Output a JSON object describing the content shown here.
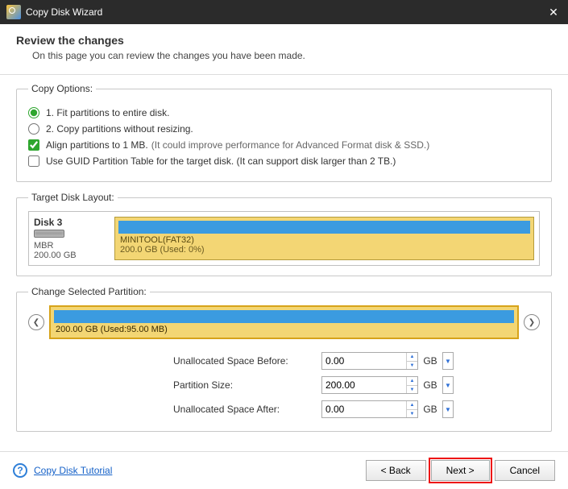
{
  "titlebar": {
    "title": "Copy Disk Wizard"
  },
  "header": {
    "title": "Review the changes",
    "subtitle": "On this page you can review the changes you have been made."
  },
  "copy_options": {
    "legend": "Copy Options:",
    "radio1": "1. Fit partitions to entire disk.",
    "radio2": "2. Copy partitions without resizing.",
    "check_align": "Align partitions to 1 MB.",
    "check_align_hint": "(It could improve performance for Advanced Format disk & SSD.)",
    "check_guid": "Use GUID Partition Table for the target disk. (It can support disk larger than 2 TB.)"
  },
  "target_layout": {
    "legend": "Target Disk Layout:",
    "disk_name": "Disk 3",
    "disk_type": "MBR",
    "disk_size": "200.00 GB",
    "part_name": "MINITOOL(FAT32)",
    "part_sub": "200.0 GB (Used: 0%)"
  },
  "change_partition": {
    "legend": "Change Selected Partition:",
    "sel_text": "200.00 GB (Used:95.00 MB)",
    "rows": {
      "before_label": "Unallocated Space Before:",
      "before_value": "0.00",
      "size_label": "Partition Size:",
      "size_value": "200.00",
      "after_label": "Unallocated Space After:",
      "after_value": "0.00",
      "unit": "GB"
    }
  },
  "footer": {
    "help": "Copy Disk Tutorial",
    "back": "< Back",
    "next": "Next >",
    "cancel": "Cancel"
  }
}
